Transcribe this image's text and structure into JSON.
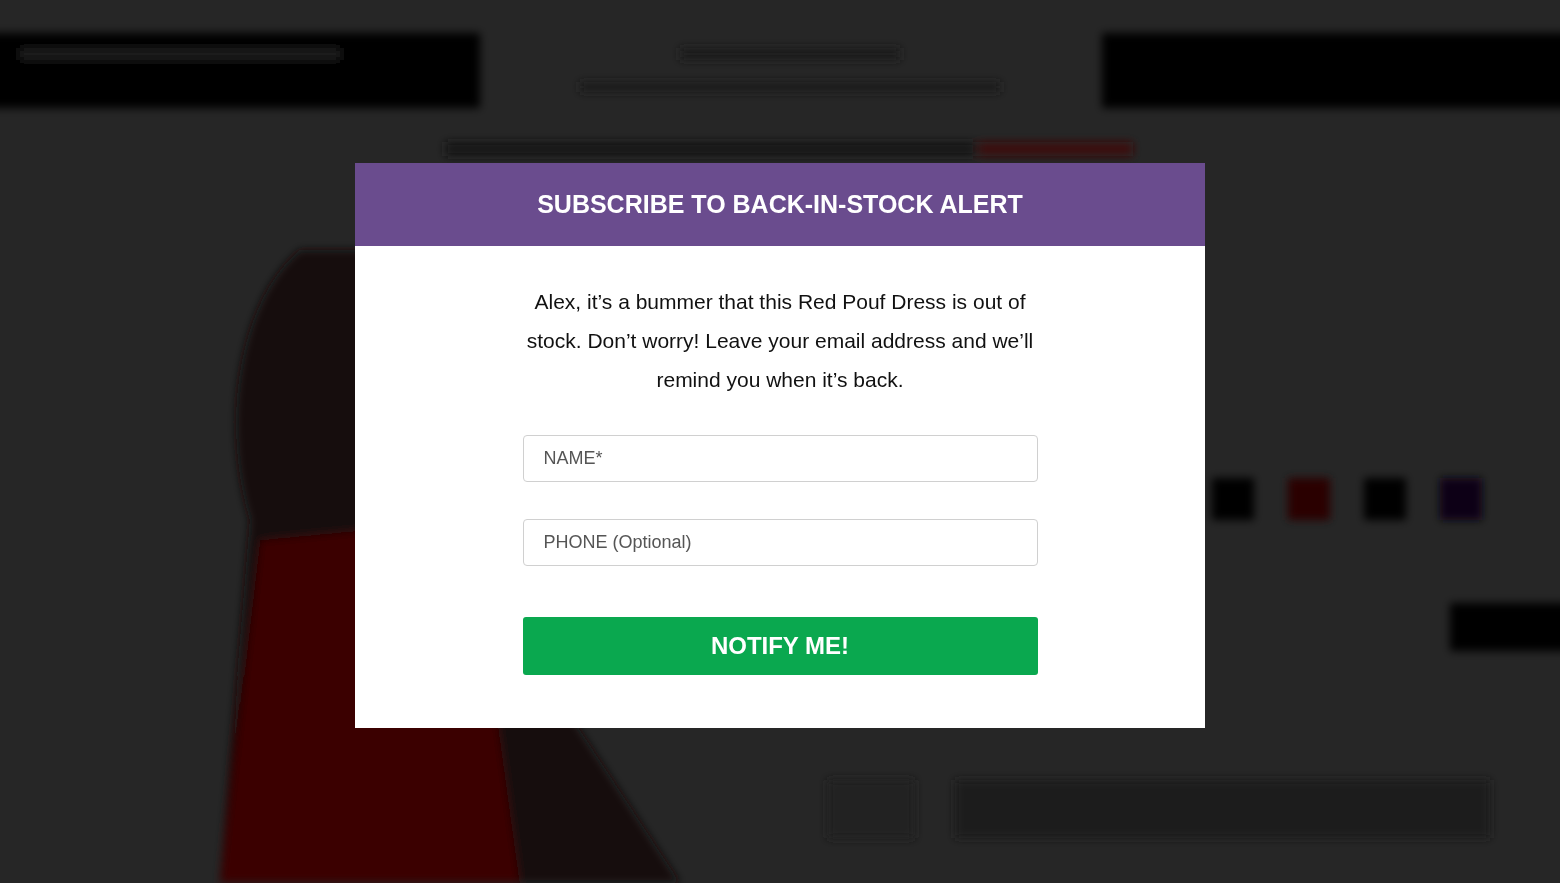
{
  "modal": {
    "title": "SUBSCRIBE TO BACK-IN-STOCK ALERT",
    "message": "Alex, it’s a bummer that this Red Pouf Dress is out of stock. Don’t worry! Leave your email address and we’ll remind you when it’s back.",
    "fields": [
      {
        "placeholder": "NAME*"
      },
      {
        "placeholder": "PHONE (Optional)"
      }
    ],
    "button": "NOTIFY ME!"
  }
}
